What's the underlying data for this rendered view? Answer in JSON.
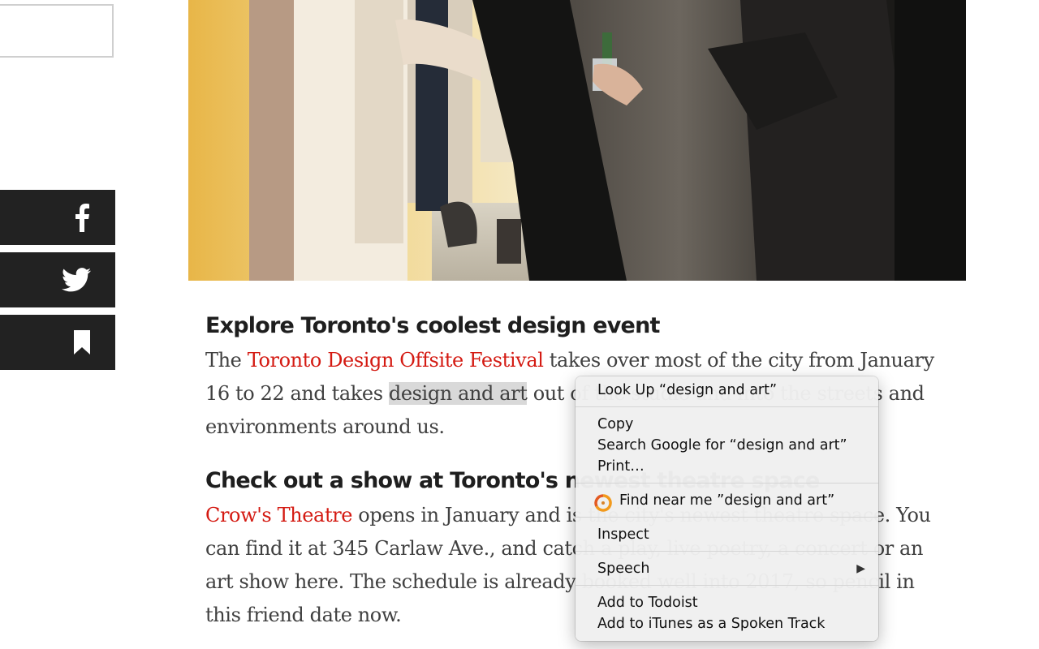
{
  "article": {
    "section1": {
      "heading": "Explore Toronto's coolest design event",
      "p_pre": "The ",
      "link": "Toronto Design Offsite Festival",
      "p_mid": " takes over most of the city from January 16 to 22 and takes ",
      "p_selected": "design and art",
      "p_post": " out of the studio and into the streets and environments around us."
    },
    "section2": {
      "heading": "Check out a show at Toronto's newest theatre space",
      "link": "Crow's Theatre",
      "p_rest": " opens in January and is the city's newest theatre space. You can find it at 345 Carlaw Ave., and catch a play, live poetry, a concert or an art show here. The schedule is already booked well into 2017, so pencil in this friend date now."
    }
  },
  "share": {
    "facebook_icon": "facebook-icon",
    "twitter_icon": "twitter-icon",
    "bookmark_icon": "bookmark-icon"
  },
  "context_menu": {
    "look_up": "Look Up “design and art”",
    "copy": "Copy",
    "search_google": "Search Google for “design and art”",
    "print": "Print…",
    "find_near_me": "Find near me ”design and art”",
    "inspect": "Inspect",
    "speech": "Speech",
    "add_todoist": "Add to Todoist",
    "add_itunes": "Add to iTunes as a Spoken Track"
  },
  "colors": {
    "link": "#d41a12",
    "share_bg": "#222222",
    "selection": "#d9d9d9"
  }
}
